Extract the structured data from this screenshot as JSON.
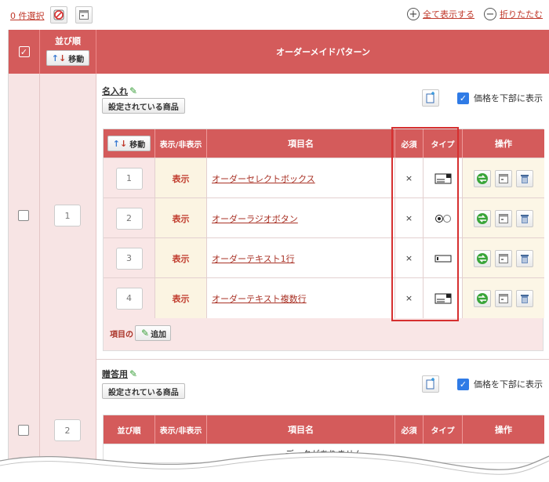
{
  "toolbar": {
    "selection_count": "0 件選択",
    "show_all": "全て表示する",
    "collapse": "折りたたむ"
  },
  "header": {
    "order_label": "並び順",
    "move_label": "移動",
    "pattern_label": "オーダーメイドパターン"
  },
  "patterns": [
    {
      "order": "1",
      "title": "名入れ",
      "set_products_label": "設定されている商品",
      "price_bottom_label": "価格を下部に表示",
      "price_bottom_checked": true
    },
    {
      "order": "2",
      "title": "贈答用",
      "set_products_label": "設定されている商品",
      "price_bottom_label": "価格を下部に表示",
      "price_bottom_checked": true
    }
  ],
  "items_table": {
    "move_label": "移動",
    "col_order": "並び順",
    "col_display": "表示/非表示",
    "col_name": "項目名",
    "col_required": "必須",
    "col_type": "タイプ",
    "col_ops": "操作",
    "add_prefix": "項目の",
    "add_label": "追加",
    "no_data": "データがありません"
  },
  "items": [
    {
      "order": "1",
      "display": "表示",
      "name": "オーダーセレクトボックス",
      "required": "×",
      "type_icon": "select-box-icon"
    },
    {
      "order": "2",
      "display": "表示",
      "name": "オーダーラジオボタン",
      "required": "×",
      "type_icon": "radio-button-icon"
    },
    {
      "order": "3",
      "display": "表示",
      "name": "オーダーテキスト1行",
      "required": "×",
      "type_icon": "text-line-icon"
    },
    {
      "order": "4",
      "display": "表示",
      "name": "オーダーテキスト複数行",
      "required": "×",
      "type_icon": "textarea-icon"
    }
  ],
  "colors": {
    "header_red": "#d45b5b",
    "accent_red": "#c0392b",
    "pink_bg": "#f7e4e4",
    "highlight_border": "#d62f2f",
    "checkbox_blue": "#2f7be6"
  }
}
